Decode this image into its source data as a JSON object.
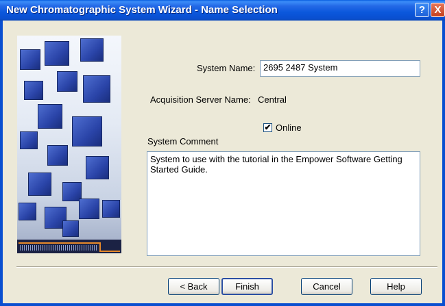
{
  "window": {
    "title": "New Chromatographic System Wizard - Name Selection"
  },
  "titlebar_buttons": {
    "help": "?",
    "close": "X"
  },
  "form": {
    "system_name_label": "System Name:",
    "system_name_value": "2695 2487 System",
    "acq_server_label": "Acquisition Server Name:",
    "acq_server_value": "Central",
    "online_label": "Online",
    "online_checked": "✔",
    "comment_label": "System Comment",
    "comment_value": "System to use with the tutorial in the Empower Software Getting Started Guide."
  },
  "buttons": {
    "back": "< Back",
    "finish": "Finish",
    "cancel": "Cancel",
    "help": "Help"
  }
}
